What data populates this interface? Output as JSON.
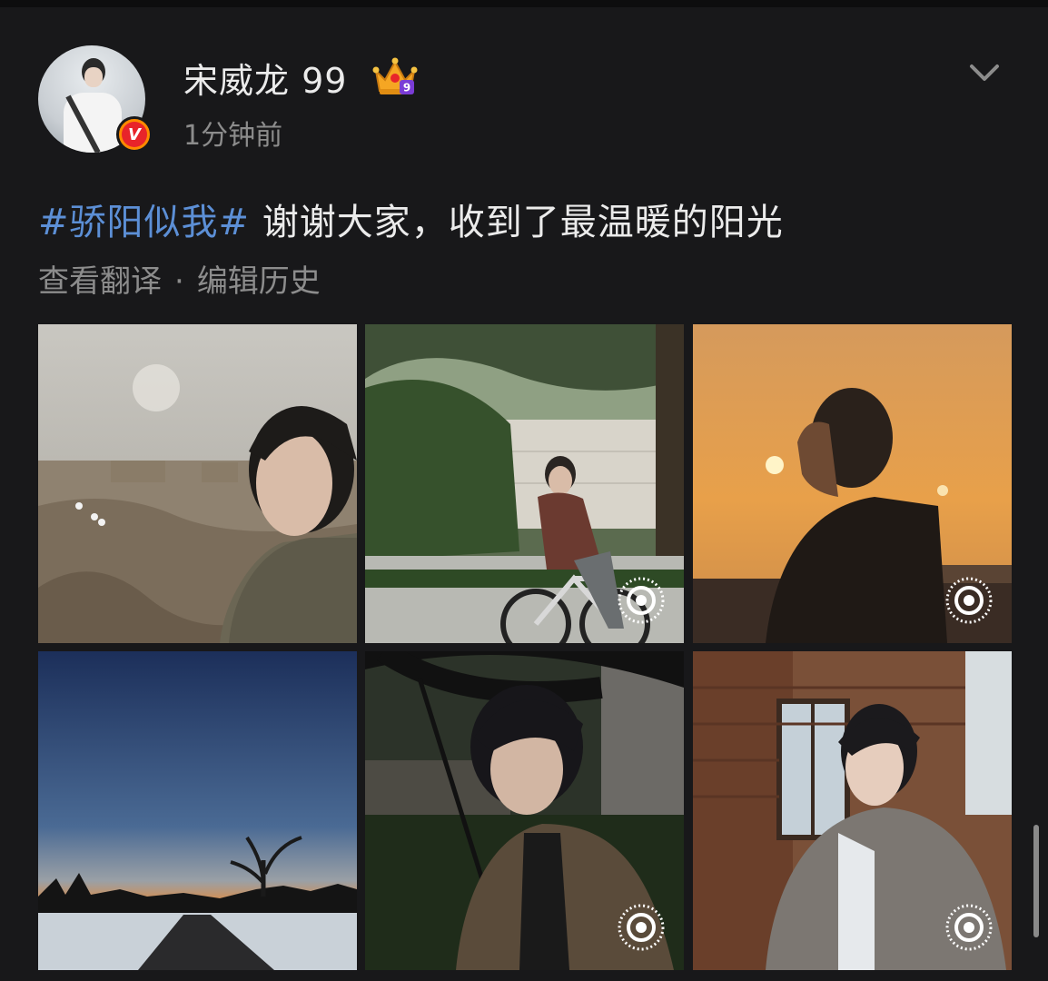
{
  "user": {
    "name": "宋威龙 99",
    "crown_level": "9",
    "time": "1分钟前",
    "verified_mark": "V"
  },
  "post": {
    "hashtag": "#骄阳似我#",
    "text": " 谢谢大家，收到了最温暖的阳光",
    "translate_label": "查看翻译",
    "separator": "·",
    "edit_history_label": "编辑历史"
  },
  "photos": [
    {
      "name": "desert-portrait",
      "has_live_badge": false
    },
    {
      "name": "bicycle-portrait",
      "has_live_badge": true
    },
    {
      "name": "sunset-portrait",
      "has_live_badge": true
    },
    {
      "name": "dusk-landscape",
      "has_live_badge": false
    },
    {
      "name": "umbrella-portrait",
      "has_live_badge": true
    },
    {
      "name": "winter-portrait",
      "has_live_badge": true
    }
  ],
  "colors": {
    "background": "#18181a",
    "hashtag": "#5c8fd6",
    "secondary_text": "#8c8c8c",
    "badge_orange": "#ff8a00",
    "badge_red": "#e8242a"
  }
}
